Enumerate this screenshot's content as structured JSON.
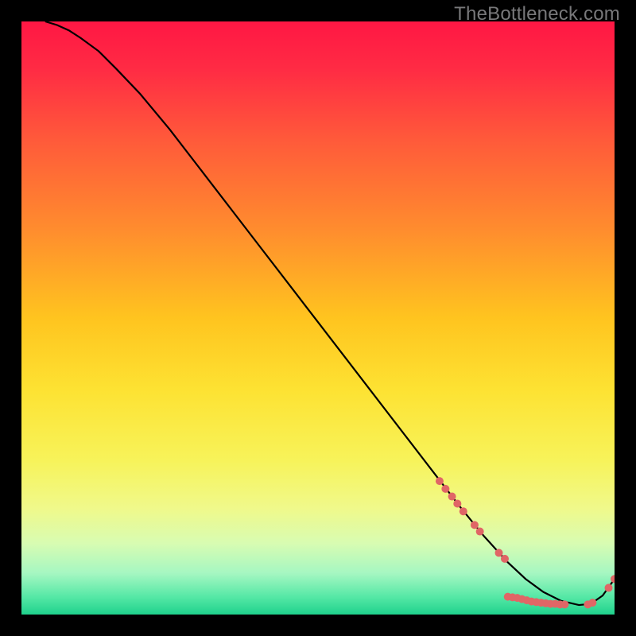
{
  "watermark": "TheBottleneck.com",
  "chart_data": {
    "type": "line",
    "title": "",
    "xlabel": "",
    "ylabel": "",
    "xlim": [
      0,
      100
    ],
    "ylim": [
      0,
      100
    ],
    "background_gradient": {
      "stops": [
        {
          "offset": 0.0,
          "color": "#ff1744"
        },
        {
          "offset": 0.08,
          "color": "#ff2b44"
        },
        {
          "offset": 0.2,
          "color": "#ff5a3a"
        },
        {
          "offset": 0.35,
          "color": "#ff8c2e"
        },
        {
          "offset": 0.5,
          "color": "#ffc41f"
        },
        {
          "offset": 0.62,
          "color": "#fde232"
        },
        {
          "offset": 0.74,
          "color": "#f7f35a"
        },
        {
          "offset": 0.82,
          "color": "#f0f98a"
        },
        {
          "offset": 0.88,
          "color": "#d8fcb2"
        },
        {
          "offset": 0.93,
          "color": "#a6f7c2"
        },
        {
          "offset": 0.97,
          "color": "#56e8a6"
        },
        {
          "offset": 1.0,
          "color": "#1fd18c"
        }
      ]
    },
    "series": [
      {
        "name": "bottleneck-curve",
        "color": "#000000",
        "x": [
          4,
          6,
          8,
          10,
          13,
          16,
          20,
          25,
          30,
          35,
          40,
          45,
          50,
          55,
          60,
          65,
          70,
          74,
          78,
          82,
          85,
          88,
          91,
          94,
          96,
          98,
          100
        ],
        "y": [
          100,
          99.4,
          98.5,
          97.2,
          95,
          92,
          87.8,
          81.8,
          75.3,
          68.8,
          62.3,
          55.8,
          49.3,
          42.8,
          36.3,
          29.8,
          23.3,
          18.1,
          13.2,
          8.8,
          6.0,
          3.8,
          2.3,
          1.6,
          1.8,
          3.2,
          6.0
        ]
      }
    ],
    "markers": {
      "color": "#e06666",
      "radius": 5,
      "points": [
        {
          "x": 70.5,
          "y": 22.5
        },
        {
          "x": 71.5,
          "y": 21.2
        },
        {
          "x": 72.6,
          "y": 19.9
        },
        {
          "x": 73.5,
          "y": 18.7
        },
        {
          "x": 74.5,
          "y": 17.4
        },
        {
          "x": 76.4,
          "y": 15.1
        },
        {
          "x": 77.3,
          "y": 14.0
        },
        {
          "x": 80.5,
          "y": 10.4
        },
        {
          "x": 81.5,
          "y": 9.4
        },
        {
          "x": 82.0,
          "y": 3.0
        },
        {
          "x": 82.8,
          "y": 2.9
        },
        {
          "x": 83.6,
          "y": 2.8
        },
        {
          "x": 84.4,
          "y": 2.6
        },
        {
          "x": 85.2,
          "y": 2.4
        },
        {
          "x": 86.0,
          "y": 2.2
        },
        {
          "x": 86.8,
          "y": 2.1
        },
        {
          "x": 87.6,
          "y": 2.0
        },
        {
          "x": 88.4,
          "y": 1.9
        },
        {
          "x": 89.2,
          "y": 1.8
        },
        {
          "x": 90.0,
          "y": 1.8
        },
        {
          "x": 90.8,
          "y": 1.7
        },
        {
          "x": 91.6,
          "y": 1.7
        },
        {
          "x": 95.5,
          "y": 1.7
        },
        {
          "x": 96.3,
          "y": 2.0
        },
        {
          "x": 99.0,
          "y": 4.5
        },
        {
          "x": 100.0,
          "y": 6.0
        }
      ]
    }
  }
}
